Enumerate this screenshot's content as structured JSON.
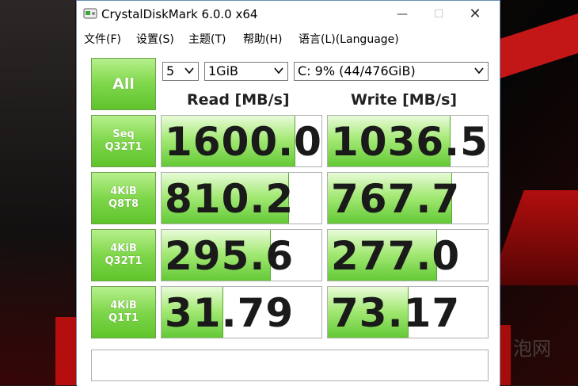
{
  "window": {
    "title": "CrystalDiskMark 6.0.0 x64",
    "min_glyph": "—",
    "max_glyph": "☐",
    "close_glyph": "✕"
  },
  "menu": [
    "文件(F)",
    "设置(S)",
    "主题(T)",
    "帮助(H)",
    "语言(L)(Language)"
  ],
  "controls": {
    "all_label": "All",
    "count": "5",
    "size": "1GiB",
    "drive": "C: 9% (44/476GiB)"
  },
  "columns": {
    "read": "Read [MB/s]",
    "write": "Write [MB/s]"
  },
  "tests": [
    {
      "line1": "Seq",
      "line2": "Q32T1",
      "read": "1600.0",
      "write": "1036.5",
      "read_level": 0.83,
      "write_level": 0.76
    },
    {
      "line1": "4KiB",
      "line2": "Q8T8",
      "read": "810.2",
      "write": "767.7",
      "read_level": 0.79,
      "write_level": 0.77
    },
    {
      "line1": "4KiB",
      "line2": "Q32T1",
      "read": "295.6",
      "write": "277.0",
      "read_level": 0.68,
      "write_level": 0.68
    },
    {
      "line1": "4KiB",
      "line2": "Q1T1",
      "read": "31.79",
      "write": "73.17",
      "read_level": 0.38,
      "write_level": 0.5
    }
  ],
  "comment": "",
  "watermark": "泡网",
  "colors": {
    "button_green": "#7fd64b",
    "bar_green": "#63c935",
    "window_border": "#6b8db5"
  }
}
